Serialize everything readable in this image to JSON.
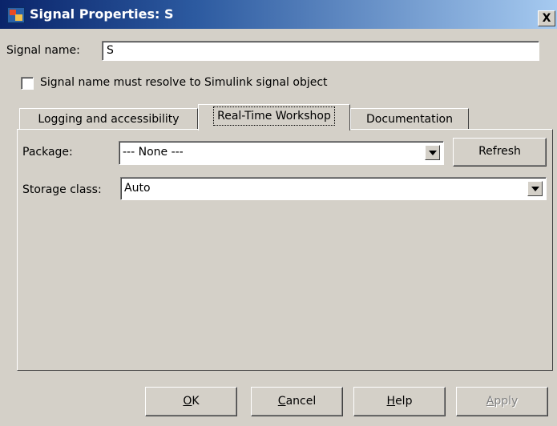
{
  "window": {
    "title": "Signal Properties: S",
    "close_label": "X"
  },
  "signal": {
    "label": "Signal name:",
    "value": "S"
  },
  "resolve": {
    "label": "Signal name must resolve to Simulink signal object",
    "checked": false
  },
  "tabs": [
    {
      "label": "Logging and accessibility",
      "active": false
    },
    {
      "label": "Real-Time Workshop",
      "active": true
    },
    {
      "label": "Documentation",
      "active": false
    }
  ],
  "rtw": {
    "package_label": "Package:",
    "package_value": "--- None ---",
    "refresh_label": "Refresh",
    "storage_label": "Storage class:",
    "storage_value": "Auto"
  },
  "buttons": {
    "ok": {
      "mnemonic": "O",
      "rest": "K"
    },
    "cancel": {
      "mnemonic": "C",
      "rest": "ancel"
    },
    "help": {
      "mnemonic": "H",
      "rest": "elp"
    },
    "apply": {
      "mnemonic": "A",
      "rest": "pply",
      "enabled": false
    }
  }
}
